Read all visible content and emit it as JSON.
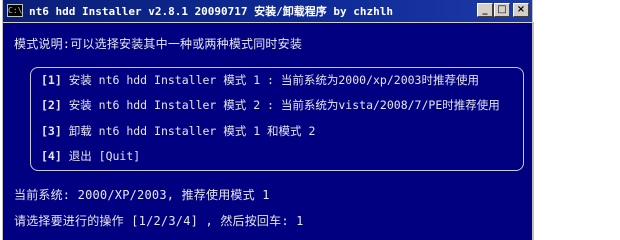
{
  "window": {
    "title": "nt6 hdd Installer v2.8.1 20090717 安装/卸载程序 by chzhlh",
    "icon_glyph": "C:\\",
    "buttons": {
      "minimize": "_",
      "maximize": "□",
      "close": "×"
    }
  },
  "console": {
    "mode_description": "模式说明:可以选择安装其中一种或两种模式同时安装",
    "menu": [
      {
        "key": "[1]",
        "text": "安装 nt6 hdd Installer 模式 1 : 当前系统为2000/xp/2003时推荐使用"
      },
      {
        "key": "[2]",
        "text": "安装 nt6 hdd Installer 模式 2 : 当前系统为vista/2008/7/PE时推荐使用"
      },
      {
        "key": "[3]",
        "text": "卸载 nt6 hdd Installer 模式 1 和模式 2"
      },
      {
        "key": "[4]",
        "text": "退出 [Quit]"
      }
    ],
    "current_system": "当前系统: 2000/XP/2003, 推荐使用模式 1",
    "prompt": "请选择要进行的操作 [1/2/3/4] , 然后按回车: 1"
  },
  "colors": {
    "console_bg": "#000080",
    "console_text": "#e6e6ee",
    "titlebar": "#0a246a"
  }
}
